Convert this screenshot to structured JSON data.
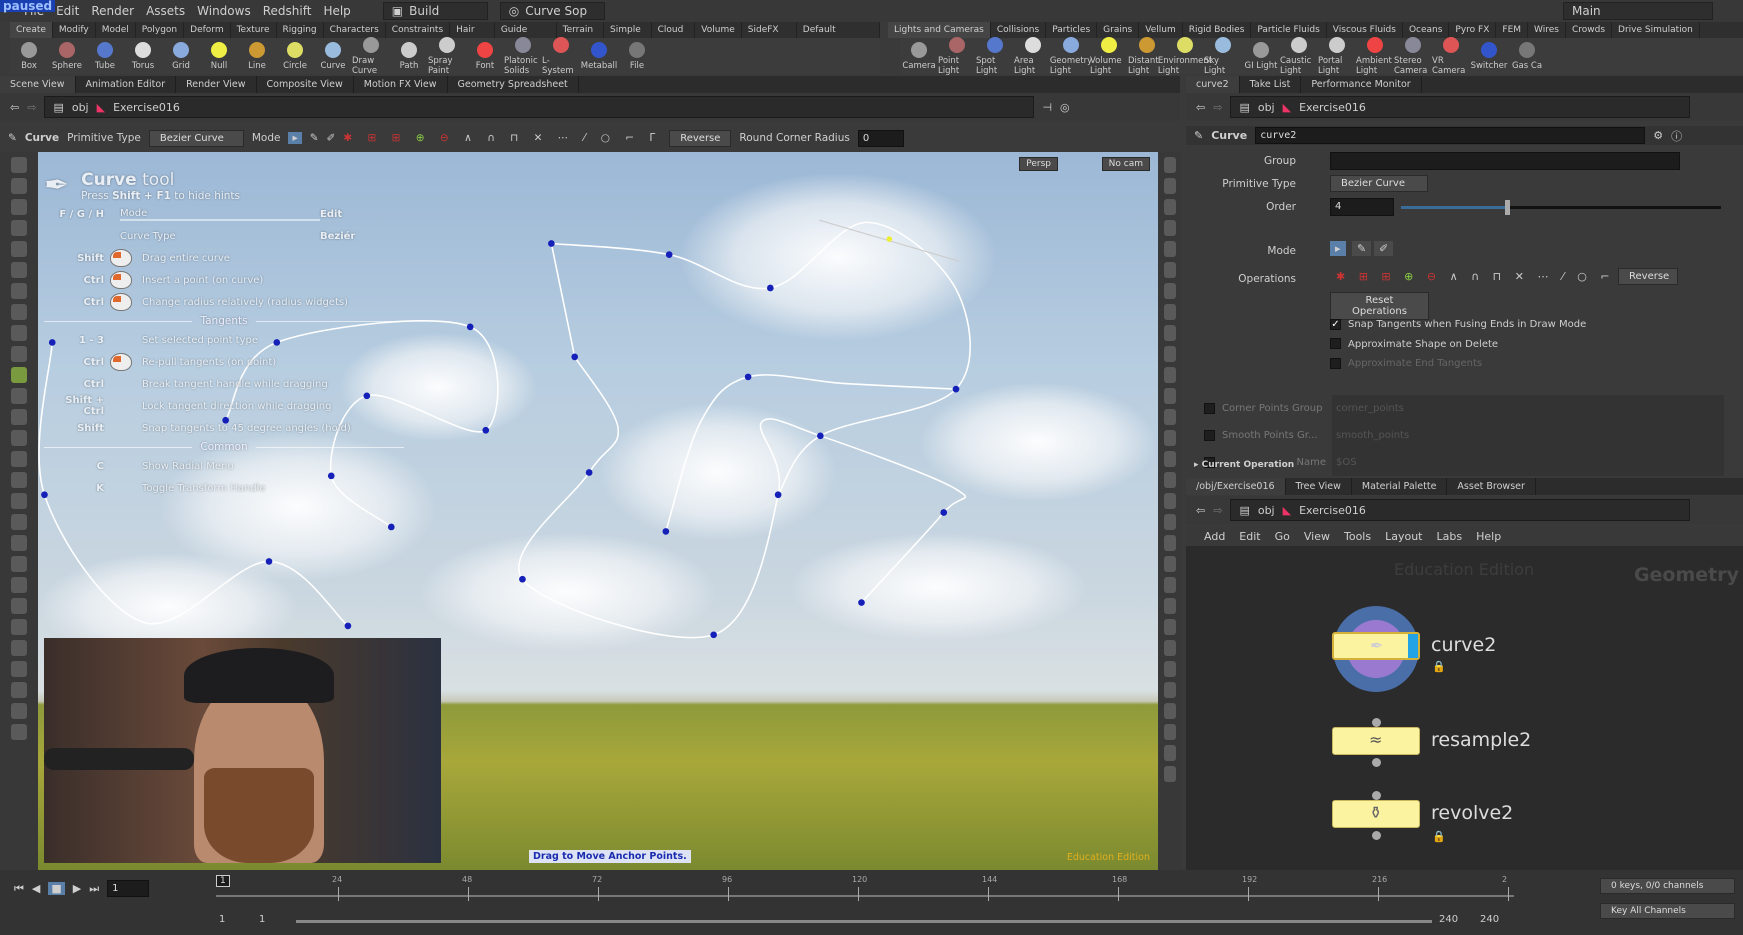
{
  "overlay": {
    "paused": "paused"
  },
  "menu": [
    "File",
    "Edit",
    "Render",
    "Assets",
    "Windows",
    "Redshift",
    "Help"
  ],
  "desktop": {
    "build": "Build",
    "context": "Curve Sop",
    "main": "Main"
  },
  "shelf_left": {
    "tabs": [
      "Create",
      "Modify",
      "Model",
      "Polygon",
      "Deform",
      "Texture",
      "Rigging",
      "Characters",
      "Constraints",
      "Hair Utils",
      "Guide Process",
      "Terrain FX",
      "Simple FX",
      "Cloud FX",
      "Volume",
      "SideFX Labs",
      "Default Redshift Li..."
    ],
    "tools": [
      "Box",
      "Sphere",
      "Tube",
      "Torus",
      "Grid",
      "Null",
      "Line",
      "Circle",
      "Curve",
      "Draw Curve",
      "Path",
      "Spray Paint",
      "Font",
      "Platonic Solids",
      "L-System",
      "Metaball",
      "File"
    ]
  },
  "shelf_right": {
    "tabs": [
      "Lights and Cameras",
      "Collisions",
      "Particles",
      "Grains",
      "Vellum",
      "Rigid Bodies",
      "Particle Fluids",
      "Viscous Fluids",
      "Oceans",
      "Pyro FX",
      "FEM",
      "Wires",
      "Crowds",
      "Drive Simulation"
    ],
    "tools": [
      "Camera",
      "Point Light",
      "Spot Light",
      "Area Light",
      "Geometry Light",
      "Volume Light",
      "Distant Light",
      "Environment Light",
      "Sky Light",
      "GI Light",
      "Caustic Light",
      "Portal Light",
      "Ambient Light",
      "Stereo Camera",
      "VR Camera",
      "Switcher",
      "Gas Ca"
    ]
  },
  "left_pane": {
    "tabs": [
      "Scene View",
      "Animation Editor",
      "Render View",
      "Composite View",
      "Motion FX View",
      "Geometry Spreadsheet"
    ],
    "path": {
      "root": "obj",
      "node": "Exercise016"
    },
    "optool": {
      "name": "Curve",
      "prim_label": "Primitive Type",
      "prim_value": "Bezier Curve",
      "mode_label": "Mode",
      "reverse": "Reverse",
      "radius_label": "Round Corner Radius",
      "radius_value": "0"
    },
    "viewport": {
      "persp": "Persp",
      "cam": "No cam",
      "status": "Drag to Move Anchor Points.",
      "edition": "Education Edition"
    }
  },
  "hints": {
    "title_bold": "Curve",
    "title_rest": "tool",
    "subtitle_pre": "Press",
    "subtitle_key": "Shift + F1",
    "subtitle_post": "to hide hints",
    "mode_keys": "F / G / H",
    "mode_label": "Mode",
    "mode_value": "Edit",
    "type_label": "Curve Type",
    "type_value": "Beziér",
    "rows1": [
      {
        "key": "Shift",
        "mouse": true,
        "text": "Drag entire curve"
      },
      {
        "key": "Ctrl",
        "mouse": true,
        "text": "Insert a point (on curve)"
      },
      {
        "key": "Ctrl",
        "mouse": true,
        "text": "Change radius relatively (radius widgets)"
      }
    ],
    "tangents": "Tangents",
    "rows2": [
      {
        "key": "1 - 3",
        "mouse": false,
        "text": "Set selected point type"
      },
      {
        "key": "Ctrl",
        "mouse": true,
        "text": "Re-pull tangents (on point)"
      },
      {
        "key": "Ctrl",
        "mouse": false,
        "text": "Break tangent handle while dragging"
      },
      {
        "key": "Shift + Ctrl",
        "mouse": false,
        "text": "Lock tangent direction while dragging"
      },
      {
        "key": "Shift",
        "mouse": false,
        "text": "Snap tangents to 45 degree angles (hold)"
      }
    ],
    "common": "Common",
    "rows3": [
      {
        "key": "C",
        "text": "Show Radial Menu"
      },
      {
        "key": "K",
        "text": "Toggle Transform Handle"
      }
    ]
  },
  "right_pane": {
    "tabs": [
      "curve2",
      "Take List",
      "Performance Monitor"
    ],
    "path": {
      "root": "obj",
      "node": "Exercise016"
    },
    "header": {
      "type": "Curve",
      "name": "curve2"
    },
    "params": {
      "group_label": "Group",
      "group_value": "",
      "prim_label": "Primitive Type",
      "prim_value": "Bezier Curve",
      "order_label": "Order",
      "order_value": "4",
      "order_slider_fraction": 0.33,
      "mode_label": "Mode",
      "ops_label": "Operations",
      "reverse": "Reverse",
      "reset_ops": "Reset Operations",
      "checks": [
        {
          "label": "Snap Tangents when Fusing Ends in Draw Mode",
          "checked": true
        },
        {
          "label": "Approximate Shape on Delete",
          "checked": false
        },
        {
          "label": "Approximate End Tangents",
          "checked": false
        }
      ],
      "corner_label": "Corner Points Group",
      "corner_value": "corner_points",
      "smooth_label": "Smooth Points Gr...",
      "smooth_value": "smooth_points",
      "name_label": "Name",
      "name_value": "$OS",
      "current_op": "Current Operation"
    }
  },
  "network_pane": {
    "tabs": [
      "/obj/Exercise016",
      "Tree View",
      "Material Palette",
      "Asset Browser"
    ],
    "path": {
      "root": "obj",
      "node": "Exercise016"
    },
    "menu": [
      "Add",
      "Edit",
      "Go",
      "View",
      "Tools",
      "Layout",
      "Labs",
      "Help"
    ],
    "watermark": "Education Edition",
    "context": "Geometry",
    "nodes": [
      "curve2",
      "resample2",
      "revolve2"
    ]
  },
  "timeline": {
    "frame": "1",
    "ticks": [
      "24",
      "48",
      "72",
      "96",
      "120",
      "144",
      "168",
      "192",
      "216",
      "2"
    ],
    "current": "1",
    "start": "1",
    "start2": "1",
    "end": "240",
    "end2": "240",
    "keys": "0 keys, 0/0 channels",
    "key_all": "Key All Channels"
  }
}
